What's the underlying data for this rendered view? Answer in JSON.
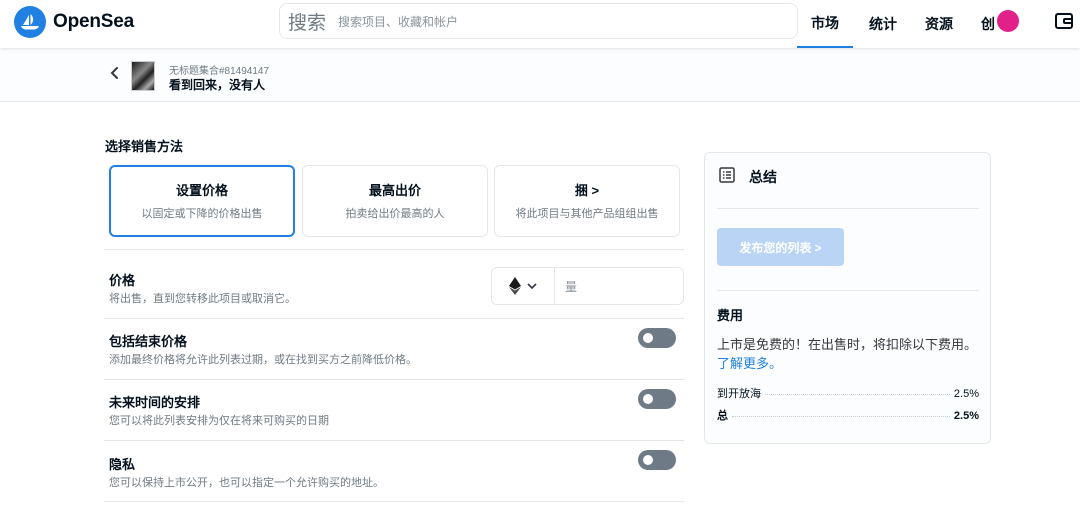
{
  "header": {
    "logo_text": "OpenSea",
    "search_label": "搜索",
    "search_placeholder": "搜索项目、收藏和帐户",
    "nav": [
      "市场",
      "统计",
      "资源",
      "创"
    ]
  },
  "subheader": {
    "collection": "无标题集合#81494147",
    "item_name": "看到回来，没有人"
  },
  "main": {
    "section_title": "选择销售方法",
    "methods": [
      {
        "title": "设置价格",
        "desc": "以固定或下降的价格出售"
      },
      {
        "title": "最高出价",
        "desc": "拍卖给出价最高的人"
      },
      {
        "title": "捆 >",
        "desc": "将此项目与其他产品组组出售"
      }
    ],
    "price": {
      "title": "价格",
      "desc": "将出售，直到您转移此项目或取消它。",
      "amount_placeholder": "量"
    },
    "options": [
      {
        "title": "包括结束价格",
        "desc": "添加最终价格将允许此列表过期，或在找到买方之前降低价格。"
      },
      {
        "title": "未来时间的安排",
        "desc": "您可以将此列表安排为仅在将来可购买的日期"
      },
      {
        "title": "隐私",
        "desc": "您可以保持上市公开，也可以指定一个允许购买的地址。"
      }
    ]
  },
  "summary": {
    "title": "总结",
    "publish_button": "发布您的列表 >",
    "fees_title": "费用",
    "fees_text": "上市是免费的！在出售时，将扣除以下费用。",
    "fees_link": "了解更多。",
    "fee_rows": [
      {
        "label": "到开放海",
        "value": "2.5%"
      },
      {
        "label": "总",
        "value": "2.5%"
      }
    ]
  },
  "colors": {
    "accent": "#2081e2",
    "toggle_off": "#6e7b86",
    "publish_disabled": "#b9d4f4"
  }
}
